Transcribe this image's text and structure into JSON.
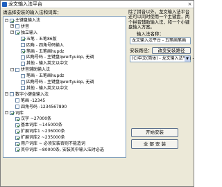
{
  "window": {
    "title": "龙文输入法平台",
    "close_glyph": "×"
  },
  "tree_label": "请选择安装的输入法和词库：",
  "tree": [
    {
      "label": "主键盘输入法",
      "depth": 1,
      "expander": "−",
      "checked": true
    },
    {
      "label": "拼音",
      "depth": 2,
      "expander": "+",
      "checked": false
    },
    {
      "label": "独立输入",
      "depth": 2,
      "expander": "−",
      "checked": true
    },
    {
      "label": "五笔 - 五笔86版",
      "depth": 3,
      "expander": "",
      "checked": true
    },
    {
      "label": "四角 - 四角号码输入",
      "depth": 3,
      "expander": "",
      "checked": false
    },
    {
      "label": "笔画 - 五笔画hupdz",
      "depth": 3,
      "expander": "",
      "checked": true
    },
    {
      "label": "四角号码 - 主键盘qwertyuiop, 无调",
      "depth": 3,
      "expander": "",
      "checked": false
    },
    {
      "label": "其他 - 输入英文以中文",
      "depth": 3,
      "expander": "",
      "checked": false
    },
    {
      "label": "拼音辅助输入法",
      "depth": 2,
      "expander": "−",
      "checked": false
    },
    {
      "label": "笔画 - 五笔画hupdz",
      "depth": 3,
      "expander": "",
      "checked": false
    },
    {
      "label": "四角号码 - 主键盘qwertyuiop, 无调",
      "depth": 3,
      "expander": "",
      "checked": false
    },
    {
      "label": "其他 - 输入英文以中文",
      "depth": 3,
      "expander": "",
      "checked": false
    },
    {
      "label": "数字小键盘输入法",
      "depth": 1,
      "expander": "−",
      "checked": false
    },
    {
      "label": "笔画 -12345",
      "depth": 2,
      "expander": "",
      "checked": false
    },
    {
      "label": "四角号码 -1234567890",
      "depth": 2,
      "expander": "",
      "checked": false
    },
    {
      "label": "词库",
      "depth": 1,
      "expander": "−",
      "checked": true
    },
    {
      "label": "汉字 ~27000条",
      "depth": 2,
      "expander": "",
      "checked": true
    },
    {
      "label": "基本词库 ~145000条",
      "depth": 2,
      "expander": "",
      "checked": true
    },
    {
      "label": "扩展词库1 ~236000条",
      "depth": 2,
      "expander": "",
      "checked": true
    },
    {
      "label": "扩展词库2 ~235000条",
      "depth": 2,
      "expander": "",
      "checked": true
    },
    {
      "label": "用户词库 ~ 必须安装否则不能造词",
      "depth": 2,
      "expander": "",
      "checked": true
    },
    {
      "label": "英中词库 ~80000条, 安装英中输入法时必选",
      "depth": 2,
      "expander": "",
      "checked": true
    }
  ],
  "description": "除了拼音以外，龙文输入法平台还可以同时使用一个主键盘，两个拼音辅助输入法，和一个小键盘输入方案。",
  "ime_name": {
    "label": "输入法名称：",
    "value": "龙文输入法平台 - 五笔画笔画"
  },
  "install_location": {
    "label": "安装路径：",
    "button": "改变安装路径"
  },
  "language": {
    "value": "(C)中文(简体) - 龙文输入法平台 -"
  },
  "buttons": {
    "start_install": "开始安装",
    "uninstall": "全 部 安 装"
  }
}
